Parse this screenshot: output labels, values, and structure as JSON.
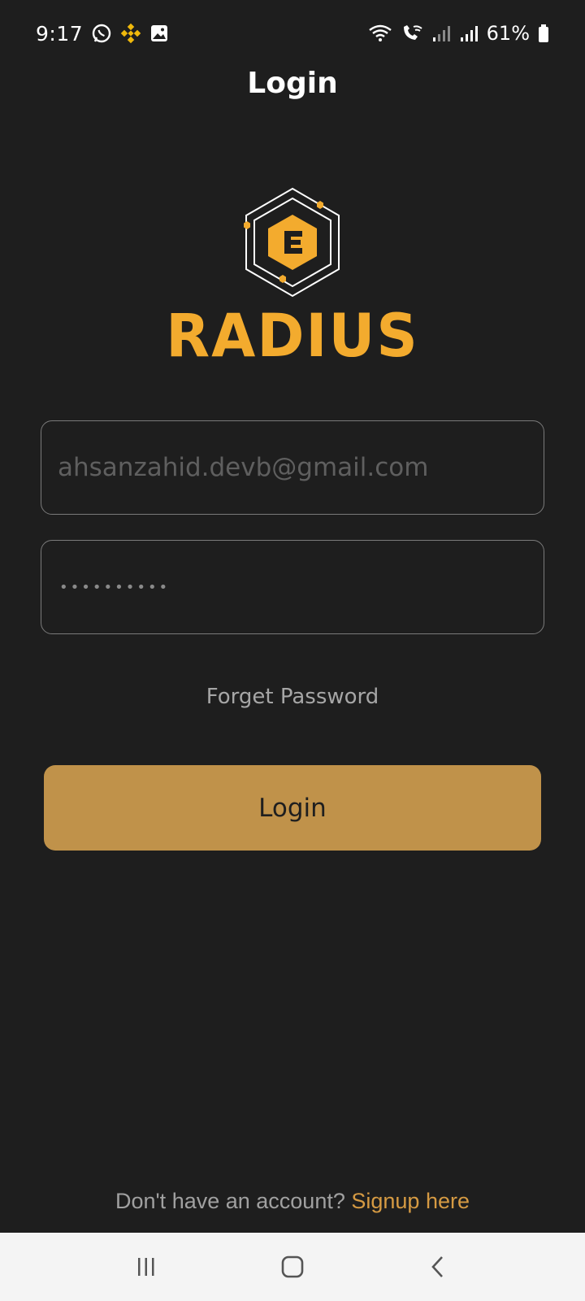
{
  "status_bar": {
    "time": "9:17",
    "battery_percent": "61%",
    "left_icons": [
      "whatsapp-icon",
      "binance-icon",
      "gallery-icon"
    ],
    "right_icons": [
      "wifi-icon",
      "wifi-calling-icon",
      "signal-icon",
      "signal-icon",
      "battery-icon"
    ]
  },
  "header": {
    "title": "Login"
  },
  "brand": {
    "name": "RADIUS",
    "accent_color": "#f3ab2e"
  },
  "form": {
    "email_value": "ahsanzahid.devb@gmail.com",
    "password_mask": "••••••••••",
    "forget_password_label": "Forget Password",
    "login_button_label": "Login"
  },
  "footer": {
    "prompt": "Don't have an account?",
    "signup_label": "Signup here"
  },
  "nav_bar": {
    "items": [
      "recent-apps-icon",
      "home-icon",
      "back-icon"
    ]
  },
  "colors": {
    "background": "#1e1e1e",
    "button": "#c0924a",
    "link": "#d59a43"
  }
}
